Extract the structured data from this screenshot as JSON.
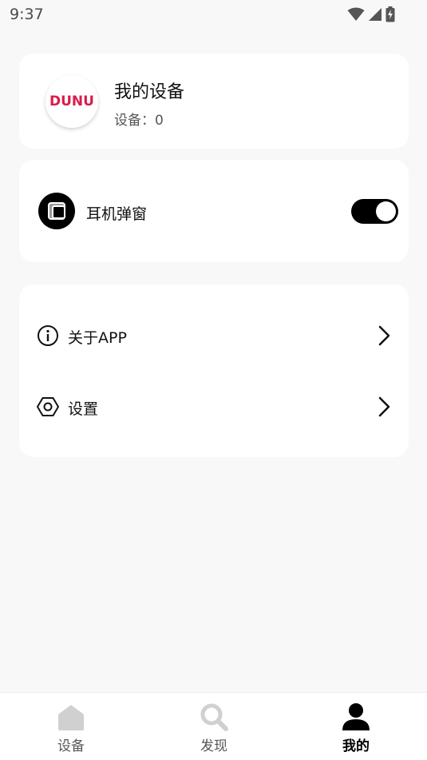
{
  "status_bar": {
    "time": "9:37",
    "icons": [
      "wifi-icon",
      "cell-signal-icon",
      "battery-charging-icon"
    ]
  },
  "device_card": {
    "brand_logo_text": "DUNU",
    "title": "我的设备",
    "count_text": "设备：0"
  },
  "popup_card": {
    "label": "耳机弹窗",
    "toggle_on": true
  },
  "menu": {
    "items": [
      {
        "label": "关于APP",
        "icon": "info-icon"
      },
      {
        "label": "设置",
        "icon": "settings-hexagon-icon"
      }
    ]
  },
  "bottom_nav": {
    "items": [
      {
        "label": "设备",
        "icon": "home-icon",
        "active": false
      },
      {
        "label": "发现",
        "icon": "search-icon",
        "active": false
      },
      {
        "label": "我的",
        "icon": "person-icon",
        "active": true
      }
    ]
  },
  "colors": {
    "background": "#f8f8f8",
    "card": "#ffffff",
    "brand": "#d81c4a",
    "toggle_on": "#000000",
    "nav_inactive_icon": "#d0d0d0"
  }
}
